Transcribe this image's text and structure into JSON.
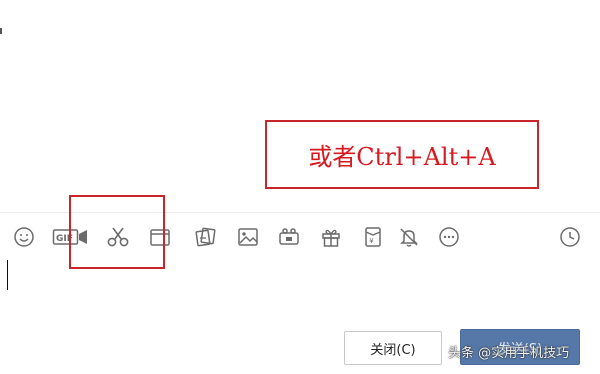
{
  "annotation": {
    "hint_text": "或者Ctrl+Alt+A",
    "color": "#d8181f"
  },
  "toolbar": {
    "icons": [
      "emoji-icon",
      "gif-icon",
      "screenshot-scissors-icon",
      "folder-icon",
      "shake-window-icon",
      "image-icon",
      "video-call-icon",
      "gift-icon",
      "red-packet-icon",
      "bell-off-icon",
      "more-icon",
      "history-clock-icon"
    ]
  },
  "buttons": {
    "close_label": "关闭(C)",
    "send_label": "发送(S)"
  },
  "watermark": {
    "text": "头条 @实用手机技巧"
  },
  "colors": {
    "send_button": "#5678a8",
    "highlight_border": "#c8262a",
    "icon_gray": "#6b6b6b"
  }
}
